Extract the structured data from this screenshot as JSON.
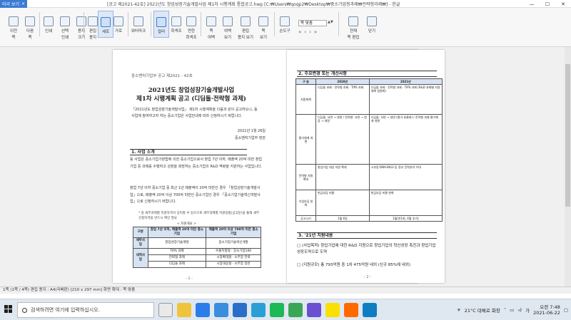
{
  "window": {
    "preview_tab": "미리 보기",
    "title": "[공고 제2021-42호] 2021년도 창업성장기술개발사업 제1차 시행계획 통합공고.hwp [C:₩Users₩qoqp2₩Desktop₩중소기업청과제₩전략형과제₩] - 한글"
  },
  "toolbar": {
    "buttons": [
      {
        "label": "이전\n쪽"
      },
      {
        "label": "다음\n쪽"
      },
      {
        "label": "인쇄"
      },
      {
        "label": "선택\n인쇄"
      },
      {
        "label": "용지\n크기"
      },
      {
        "label": "편집\n용지"
      },
      {
        "label": "세로"
      },
      {
        "label": "가로"
      },
      {
        "label": "워터마크"
      },
      {
        "label": "컬러"
      },
      {
        "label": "회색조"
      },
      {
        "label": "연한\n회색조"
      },
      {
        "label": "쪽\n여백"
      },
      {
        "label": "여백\n보기"
      },
      {
        "label": "편집\n용지 보기"
      },
      {
        "label": "쪽\n보기"
      },
      {
        "label": "손도구"
      },
      {
        "label": "현재\n쪽 편집"
      },
      {
        "label": "닫기"
      }
    ],
    "zoom_value": "쪽 맞춤"
  },
  "doc": {
    "pub": "중소벤처기업부 공고 제2021 - 42호",
    "title1": "2021년도 창업성장기술개발사업",
    "title2": "제1차 시행계획 공고 (디딤돌·전략형 과제)",
    "intro": "「2021년도 창업성장기술개발사업」 제1차 시행계획을 다음과 같이 공고하오니, 동 사업에 참여하고자 하는 중소기업은 사업안내에 따라 신청하시기 바랍니다.",
    "date": "2021년 1월 26일",
    "org": "중소벤처기업부 장관",
    "sec1": "1. 사업 소개",
    "p1": "동 사업은 중소기업기본법에 의한 중소기업으로서 창업 7년 이하, 매출액 20억 미만 창업기업 중 과제를 수행하고 성장을 희망하는 중소기업의 R&D 역량을 지원하는 사업입니다.",
    "p2": "창업 7년 이하 중소기업 중 최근 1년 매출액이 20억 미만인 경우 「창업성장기술개발사업」으로, 매출액 20억 이상 700억 미만인 중소기업인 경우 「중소기업기술혁신개발사업」으로 신청하시기 바랍니다.",
    "note": "* 중 세부과제별 지원자격이 상이할 수 있으므로 세부과제별 지원방법(공고문)을 통해 세부 신청자격을 반드시 확인 필요",
    "table_caption": "< 지원개요 >",
    "table_head": [
      "구분",
      "창업 7년 이하, 매출액 20억 미만 중소기업",
      "매출액 20억 이상 700억 미만 중소기업"
    ],
    "table_rows": [
      [
        "세부사업",
        "창업성장기술개발",
        "중소기업기술혁신개발"
      ],
      [
        "내역사업",
        "TIPS 과제",
        "수출지향형 · 강소기업100"
      ],
      [
        "",
        "전략형 과제",
        "시장확대형 · 소부장 전략"
      ],
      [
        "",
        "디딤돌 과제",
        "시장대응형 · 소부장 일반"
      ]
    ],
    "page_left": "- 1 -",
    "sec2": "2. 주요변경 또는 개선사항",
    "compare_head": [
      "구 분",
      "2020년",
      "2021년"
    ],
    "compare_rows": [
      [
        "지원체계",
        "디딤돌 과제 · 전략형 과제 · TIPS 과제",
        "디딤돌 과제 · 전략형 과제 · TIPS 과제 (R&D 과제별 지원체계 일원화)"
      ],
      [
        "평가체계 개편",
        "디딤돌: 서면 → 대면 / 전략형: 서면 → 현장 → 대면",
        "디딤돌: 서면 → 대면 (평가 효율화) / 전략형 과제 평가체계 개편"
      ],
      [
        "전략형 지원 확대",
        "창업기업 대상 지원 확대",
        "소부장·DNA·BIG3 등 정부 전략분야 우대"
      ],
      [
        "기업부담 완화",
        "현금부담 비율",
        "현금부담 비율 완화"
      ],
      [
        "공고시기",
        "1월 6일",
        "1월(연1회, 4월 추가)"
      ]
    ],
    "sec3": "3. '21년 지원내용",
    "l1": "□ (사업목적) 창업기업에 대한 R&D 지원으로 창업기업의 혁신성장 촉진과 창업기업 성장도약으로 도약",
    "l2": "□ (지원규모) 총 793억원 중 1차 475억원 내외 (신규 85%에 내외)",
    "page_right": "- 2 -"
  },
  "status": "1쪽 (1쪽 / 4쪽) 편집 용지 : A4(국배판) [210 x 297 mm] 화면 확대 : 쪽 맞춤",
  "taskbar": {
    "search_placeholder": "검색하려면 여기에 입력하십시오.",
    "weather": "21°C 대체로 화창",
    "ime": "가",
    "time": "오전 7:48",
    "date": "2021-06-22"
  }
}
